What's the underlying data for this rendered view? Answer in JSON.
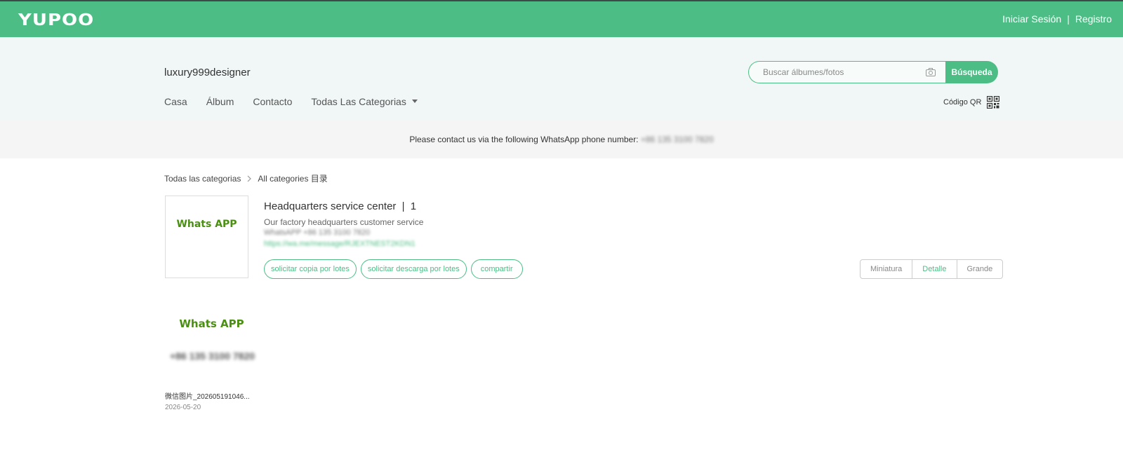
{
  "brand": {
    "logo_text": "YUPOO"
  },
  "auth": {
    "login": "Iniciar Sesión",
    "separator": "|",
    "register": "Registro"
  },
  "store": {
    "name": "luxury999designer"
  },
  "search": {
    "placeholder": "Buscar álbumes/fotos",
    "button": "Búsqueda"
  },
  "nav": {
    "home": "Casa",
    "album": "Álbum",
    "contact": "Contacto",
    "categories": "Todas Las Categorias"
  },
  "qr": {
    "label": "Código QR"
  },
  "notice": {
    "text": "Please contact us via the following WhatsApp phone number:",
    "phone": "+86 135 3100 7820"
  },
  "breadcrumb": {
    "root": "Todas las categorias",
    "current": "All categories 目录"
  },
  "album": {
    "cover_text": "Whats APP",
    "title": "Headquarters service center",
    "count_sep": "|",
    "count": "1",
    "description": "Our factory headquarters customer service",
    "whatsapp_line": "WhatsAPP +86 135 3100 7820",
    "link": "https://wa.me/message/RJEXTNEST2KDN1"
  },
  "actions": {
    "copy": "solicitar copia por lotes",
    "download": "solicitar descarga por lotes",
    "share": "compartir"
  },
  "view_modes": {
    "thumb": "Miniatura",
    "detail": "Detalle",
    "large": "Grande",
    "active": "Detalle"
  },
  "photos": [
    {
      "image_text": "Whats APP",
      "image_number": "+86 135 3100 7820",
      "name": "微信图片_202605191046...",
      "date": "2026-05-20"
    }
  ],
  "colors": {
    "brand": "#4cbe85",
    "topbar_border": "#3d4a47",
    "header_bg": "#f1f7f6",
    "notice_bg": "#f5f5f5",
    "whatsapp_green": "#4a8f12"
  }
}
